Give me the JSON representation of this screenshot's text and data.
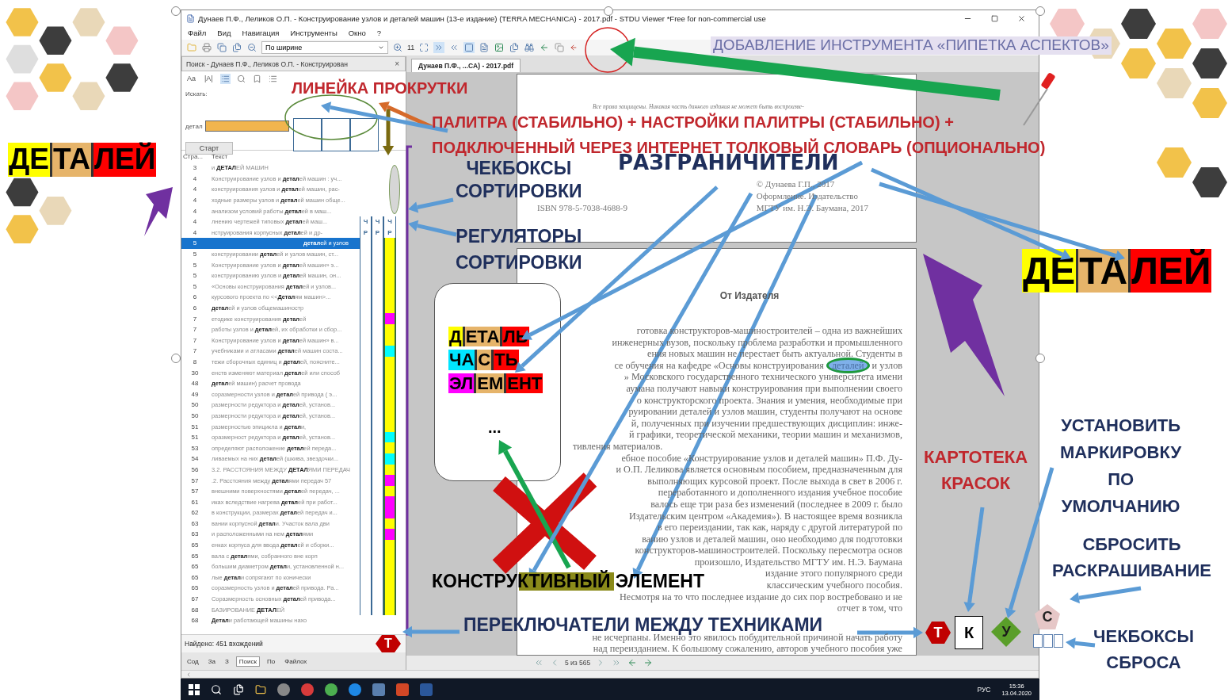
{
  "window": {
    "title": "Дунаев П.Ф., Леликов О.П. - Конструирование узлов и деталей машин (13-е издание) (TERRA MECHANICA) - 2017.pdf - STDU Viewer *Free for non-commercial use"
  },
  "menu": [
    "Файл",
    "Вид",
    "Навигация",
    "Инструменты",
    "Окно",
    "?"
  ],
  "toolbar": {
    "zoom_mode": "По ширине",
    "page_box": "11"
  },
  "search_tab": {
    "label": "Поиск - Дунаев П.Ф., Леликов О.П. - Конструирован",
    "close": "×"
  },
  "search_options": [
    {
      "label": "Aa",
      "selected": false
    },
    {
      "label": "|A|",
      "selected": false
    }
  ],
  "search": {
    "label": "Искать:",
    "field_label": "детал",
    "button": "Старт"
  },
  "results": {
    "columns": [
      "Стра...",
      "Текст"
    ],
    "rows": [
      {
        "page": "3",
        "pre": "и ",
        "match": "ДЕТАЛ",
        "post": "ЕЙ МАШИН",
        "selected": false
      },
      {
        "page": "4",
        "pre": "Конструирование узлов и ",
        "match": "детал",
        "post": "ей машин : уч...",
        "selected": false
      },
      {
        "page": "4",
        "pre": "конструирования узлов и ",
        "match": "детал",
        "post": "ей машин, рас-",
        "selected": false
      },
      {
        "page": "4",
        "pre": "ходные размеры узлов и ",
        "match": "детал",
        "post": "ей машин обще...",
        "selected": false
      },
      {
        "page": "4",
        "pre": "анализом условий работы ",
        "match": "детал",
        "post": "ей в маш...",
        "selected": false
      },
      {
        "page": "4",
        "pre": "лнению чертежей типовых ",
        "match": "детал",
        "post": "ей маш...",
        "selected": false,
        "marks": [
          "Ч",
          "Ч",
          "Ч"
        ]
      },
      {
        "page": "4",
        "pre": "нструирования корпусных ",
        "match": "детал",
        "post": "ей и др-",
        "selected": false,
        "marks": [
          "Р",
          "Р",
          "Р"
        ]
      },
      {
        "page": "5",
        "pre": "",
        "match": "детал",
        "post": "ей и узлов",
        "selected": true,
        "color": "#ffff00"
      },
      {
        "page": "5",
        "pre": "конструировании ",
        "match": "детал",
        "post": "ей и узлов машин, ст...",
        "selected": false,
        "color": "#ffff00"
      },
      {
        "page": "5",
        "pre": "Конструирование узлов и ",
        "match": "детал",
        "post": "ей машин» э...",
        "selected": false,
        "color": "#ffff00"
      },
      {
        "page": "5",
        "pre": "конструированию узлов и ",
        "match": "детал",
        "post": "ей машин, он...",
        "selected": false,
        "color": "#ffff00"
      },
      {
        "page": "5",
        "pre": "«Основы конструирования ",
        "match": "детал",
        "post": "ей и узлов...",
        "selected": false,
        "color": "#ffff00"
      },
      {
        "page": "6",
        "pre": "курсового проекта по <<",
        "match": "Детал",
        "post": "ям машин>...",
        "selected": false,
        "color": "#ffff00"
      },
      {
        "page": "6",
        "pre": "",
        "match": "детал",
        "post": "ей и узлов общемашиностр",
        "selected": false,
        "color": "#ffff00"
      },
      {
        "page": "7",
        "pre": "етодике конструирования ",
        "match": "детал",
        "post": "ей",
        "selected": false,
        "color": "#ff00ff"
      },
      {
        "page": "7",
        "pre": "работы узлов и ",
        "match": "детал",
        "post": "ей, их обработки и сбор...",
        "selected": false,
        "color": "#ffff00"
      },
      {
        "page": "7",
        "pre": "Конструирование узлов и ",
        "match": "детал",
        "post": "ей машин» в...",
        "selected": false,
        "color": "#ffff00"
      },
      {
        "page": "7",
        "pre": "учебниками и атласами ",
        "match": "детал",
        "post": "ей машин соста...",
        "selected": false,
        "color": "#00ffff"
      },
      {
        "page": "8",
        "pre": "тежи сборочных единиц и ",
        "match": "детал",
        "post": "ей, поясните...",
        "selected": false,
        "color": "#ffff00"
      },
      {
        "page": "30",
        "pre": "енств изменяют материал ",
        "match": "детал",
        "post": "ей или способ",
        "selected": false,
        "color": "#ffff00"
      },
      {
        "page": "48",
        "pre": "",
        "match": "детал",
        "post": "ей машин) расчет провода",
        "selected": false,
        "color": "#ffff00"
      },
      {
        "page": "49",
        "pre": "соразмерности узлов и ",
        "match": "детал",
        "post": "ей привода ( э...",
        "selected": false,
        "color": "#ffff00"
      },
      {
        "page": "50",
        "pre": "размерности редуктора и ",
        "match": "детал",
        "post": "ей, установ...",
        "selected": false,
        "color": "#ffff00"
      },
      {
        "page": "50",
        "pre": "размерности редуктора и ",
        "match": "детал",
        "post": "ей, установ...",
        "selected": false,
        "color": "#ffff00"
      },
      {
        "page": "51",
        "pre": "размерностью эпицикла и ",
        "match": "детал",
        "post": "и,",
        "selected": false,
        "color": "#ffff00"
      },
      {
        "page": "51",
        "pre": "оразмерност редуктора и ",
        "match": "детал",
        "post": "ей, установ...",
        "selected": false,
        "color": "#00ffff"
      },
      {
        "page": "53",
        "pre": "определяют расположение ",
        "match": "детал",
        "post": "ей переда...",
        "selected": false,
        "color": "#ffff00"
      },
      {
        "page": "54",
        "pre": "ливаемых на них ",
        "match": "детал",
        "post": "ей (шкива, звездочки...",
        "selected": false,
        "color": "#00ffff"
      },
      {
        "page": "56",
        "pre": "3.2. РАССТОЯНИЯ МЕЖДУ ",
        "match": "ДЕТАЛ",
        "post": "ЯМИ ПЕРЕДАЧ",
        "selected": false,
        "color": "#ffff00"
      },
      {
        "page": "57",
        "pre": ".2. Расстояния между ",
        "match": "детал",
        "post": "ями передач 57",
        "selected": false,
        "color": "#ff00ff"
      },
      {
        "page": "57",
        "pre": "внешними поверхностями ",
        "match": "детал",
        "post": "ей передач, ...",
        "selected": false,
        "color": "#ffff00"
      },
      {
        "page": "61",
        "pre": "иках вследствие нагрева ",
        "match": "детал",
        "post": "ей при работ...",
        "selected": false,
        "color": "#ff00ff"
      },
      {
        "page": "62",
        "pre": "в конструкции, размерах ",
        "match": "детал",
        "post": "ей передач и...",
        "selected": false,
        "color": "#ff00ff"
      },
      {
        "page": "63",
        "pre": "вании корпусной ",
        "match": "детал",
        "post": "и. Участок вала дви",
        "selected": false,
        "color": "#ffff00"
      },
      {
        "page": "63",
        "pre": "и расположенными на нем ",
        "match": "детал",
        "post": "ями",
        "selected": false,
        "color": "#ff00ff"
      },
      {
        "page": "65",
        "pre": "енках корпуса для ввода ",
        "match": "детал",
        "post": "ей и сборки...",
        "selected": false,
        "color": "#ffff00"
      },
      {
        "page": "65",
        "pre": "вала с ",
        "match": "детал",
        "post": "ями, собранного вне корп",
        "selected": false,
        "color": "#ffff00"
      },
      {
        "page": "65",
        "pre": "большим диаметром ",
        "match": "детал",
        "post": "и, установленной н...",
        "selected": false,
        "color": "#ffff00"
      },
      {
        "page": "65",
        "pre": "лые ",
        "match": "детал",
        "post": "и сопрягают по конически",
        "selected": false,
        "color": "#ffff00"
      },
      {
        "page": "65",
        "pre": "соразмерность узлов и ",
        "match": "детал",
        "post": "ей привода. Ра...",
        "selected": false,
        "color": "#ffff00"
      },
      {
        "page": "67",
        "pre": "Соразмерность основных ",
        "match": "детал",
        "post": "ей привода...",
        "selected": false,
        "color": "#ffff00"
      },
      {
        "page": "68",
        "pre": "БАЗИРОВАНИЕ ",
        "match": "ДЕТАЛ",
        "post": "ЕЙ",
        "selected": false,
        "color": "#ffff00"
      },
      {
        "page": "68",
        "pre": "",
        "match": "Детал",
        "post": "и работающей машины нахо",
        "selected": false
      }
    ],
    "status": "Найдено: 451 вхождений"
  },
  "panel_tabs": [
    {
      "label": "Сод",
      "selected": false
    },
    {
      "label": "За",
      "selected": false
    },
    {
      "label": "З",
      "selected": false
    },
    {
      "label": "Поиск",
      "selected": true
    },
    {
      "label": "По",
      "selected": false
    },
    {
      "label": "Файлох",
      "selected": false
    }
  ],
  "panel_switch": "Т",
  "document": {
    "tab": "Дунаев П.Ф., ...CA) - 2017.pdf",
    "notice": "Все права защищены. Никакая часть данного издания не может быть воспроизве-",
    "isbn": "ISBN 978-5-7038-4688-9",
    "copyright": [
      "© Дунаева Г.П., 2017",
      "Оформление. Издательство",
      "МГТУ им. Н.Э. Баумана, 2017"
    ],
    "heading": "От Издателя",
    "lines": [
      {
        "kind": "line",
        "text": "готовка конструкторов-машиностроителей – одна из важнейших"
      },
      {
        "kind": "line",
        "text": "инженерных вузов, поскольку проблема разработки и промышленного"
      },
      {
        "kind": "line",
        "text": "ения новых машин не перестает быть актуальной. Студенты в"
      },
      {
        "kind": "highlight",
        "text": "се обучения на кафедре «Основы конструирования",
        "mark": "деталей",
        "rest": "и узлов"
      },
      {
        "kind": "line",
        "text": "» Московского государственного технического университета имени"
      },
      {
        "kind": "line",
        "text": "аумана получают навыки конструирования при выполнении своего"
      },
      {
        "kind": "line",
        "text": "о конструкторского проекта. Знания и умения, необходимые при"
      },
      {
        "kind": "line",
        "text": "руировании деталей и узлов машин, студенты получают на основе"
      },
      {
        "kind": "line",
        "text": "й, полученных при изучении предшествующих дисциплин: инже-"
      },
      {
        "kind": "line",
        "text": "й графики, теоретической механики, теории машин и механизмов,"
      },
      {
        "kind": "end",
        "text": "тивления материалов."
      },
      {
        "kind": "line",
        "text": "ебное пособие «Конструирование узлов и деталей машин» П.Ф. Ду-"
      },
      {
        "kind": "line",
        "text": "и О.П. Леликова является основным пособием, предназначенным для"
      },
      {
        "kind": "line",
        "text": "выполняющих курсовой проект. После выхода в свет в 2006 г."
      },
      {
        "kind": "line",
        "text": "переработанного и дополненного издания учебное пособие"
      },
      {
        "kind": "line",
        "text": "валось еще три раза без изменений (последнее в 2009 г. было"
      },
      {
        "kind": "line",
        "text": "Издательским центром «Академия»). В настоящее время возникла"
      },
      {
        "kind": "line",
        "text": "в его переиздании, так как, наряду с другой литературой по"
      },
      {
        "kind": "line",
        "text": "ванию узлов и деталей машин, оно необходимо для подготовки"
      },
      {
        "kind": "line",
        "text": "конструкторов-машиностроителей. Поскольку пересмотра основ"
      },
      {
        "kind": "line",
        "text": "произошло, Издательство МГТУ им. Н.Э. Баумана"
      },
      {
        "kind": "line",
        "text": "издание этого популярного среди"
      },
      {
        "kind": "line",
        "text": "классическим учебного пособия."
      },
      {
        "kind": "indent",
        "text": "Несмотря на то что последнее издание до сих пор востребовано и не"
      },
      {
        "kind": "line",
        "text": "отчет в том, что"
      },
      {
        "kind": "resume",
        "text": "не исчерпаны. Именно это явилось побудительной причиной начать работу"
      },
      {
        "kind": "line",
        "text": "над переизданием. К большому сожалению, авторов учебного пособия уже"
      }
    ]
  },
  "navigation": {
    "page": "5 из 565"
  },
  "taskbar": {
    "language": "РУС",
    "time": "15:36",
    "date": "13.04.2020"
  },
  "annotations": {
    "pipette": "ДОБАВЛЕНИЕ ИНСТРУМЕНТА «ПИПЕТКА АСПЕКТОВ»",
    "scroll_ruler": "ЛИНЕЙКА ПРОКРУТКИ",
    "palette": [
      "ПАЛИТРА (СТАБИЛЬНО) + НАСТРОЙКИ ПАЛИТРЫ (СТАБИЛЬНО) +",
      "ПОДКЛЮЧЕННЫЙ ЧЕРЕЗ ИНТЕРНЕТ ТОЛКОВЫЙ СЛОВАРЬ (ОПЦИОНАЛЬНО)"
    ],
    "sort_checkboxes": "ЧЕКБОКСЫ\nСОРТИРОВКИ",
    "delimiters": "РАЗГРАНИЧИТЕЛИ",
    "sort_regulators": "РЕГУЛЯТОРЫ\nСОРТИРОВКИ",
    "construct_element": "КОНСТРУКТИВНЫЙ ЭЛЕМЕНТ",
    "technique_switchers": "ПЕРЕКЛЮЧАТЕЛИ МЕЖДУ ТЕХНИКАМИ",
    "paint_file": "КАРТОТЕКА\nКРАСОК",
    "default_marking": "УСТАНОВИТЬ\nМАРКИРОВКУ\nПО\nУМОЛЧАНИЮ",
    "reset_coloring": "СБРОСИТЬ\nРАСКРАШИВАНИЕ",
    "reset_checkboxes": "ЧЕКБОКСЫ\nСБРОСА"
  },
  "word_tiles": {
    "left": [
      {
        "text": "ДЕ",
        "color": "#ffff00"
      },
      {
        "text": "ТА",
        "color": "#e6b46a"
      },
      {
        "text": "ЛЕЙ",
        "color": "#ff0000"
      }
    ],
    "right": [
      {
        "text": "ДЕ",
        "color": "#ffff00"
      },
      {
        "text": "ТА",
        "color": "#e6b46a"
      },
      {
        "text": "ЛЕЙ",
        "color": "#ff0000"
      }
    ]
  },
  "element_card": {
    "words": [
      [
        {
          "text": "Д",
          "color": "#ffff00"
        },
        {
          "text": "ЕТА",
          "color": "#e6b46a"
        },
        {
          "text": "ЛЬ",
          "color": "#ff0000"
        }
      ],
      [
        {
          "text": "ЧА",
          "color": "#00e5ff"
        },
        {
          "text": "С",
          "color": "#e6b46a"
        },
        {
          "text": "ТЬ",
          "color": "#ff0000"
        }
      ],
      [
        {
          "text": "ЭЛ",
          "color": "#ff00ff"
        },
        {
          "text": "ЕМ",
          "color": "#e6b46a"
        },
        {
          "text": "ЕНТ",
          "color": "#ff0000"
        }
      ]
    ],
    "more": "..."
  },
  "reset_checkboxes": [
    {
      "checked": false
    },
    {
      "checked": false
    },
    {
      "checked": false
    }
  ],
  "technique_buttons": [
    {
      "label": "Т",
      "kind": "hexagon"
    },
    {
      "label": "К",
      "kind": "square"
    },
    {
      "label": "У",
      "kind": "diamond"
    },
    {
      "label": "С",
      "kind": "pentagon"
    }
  ]
}
